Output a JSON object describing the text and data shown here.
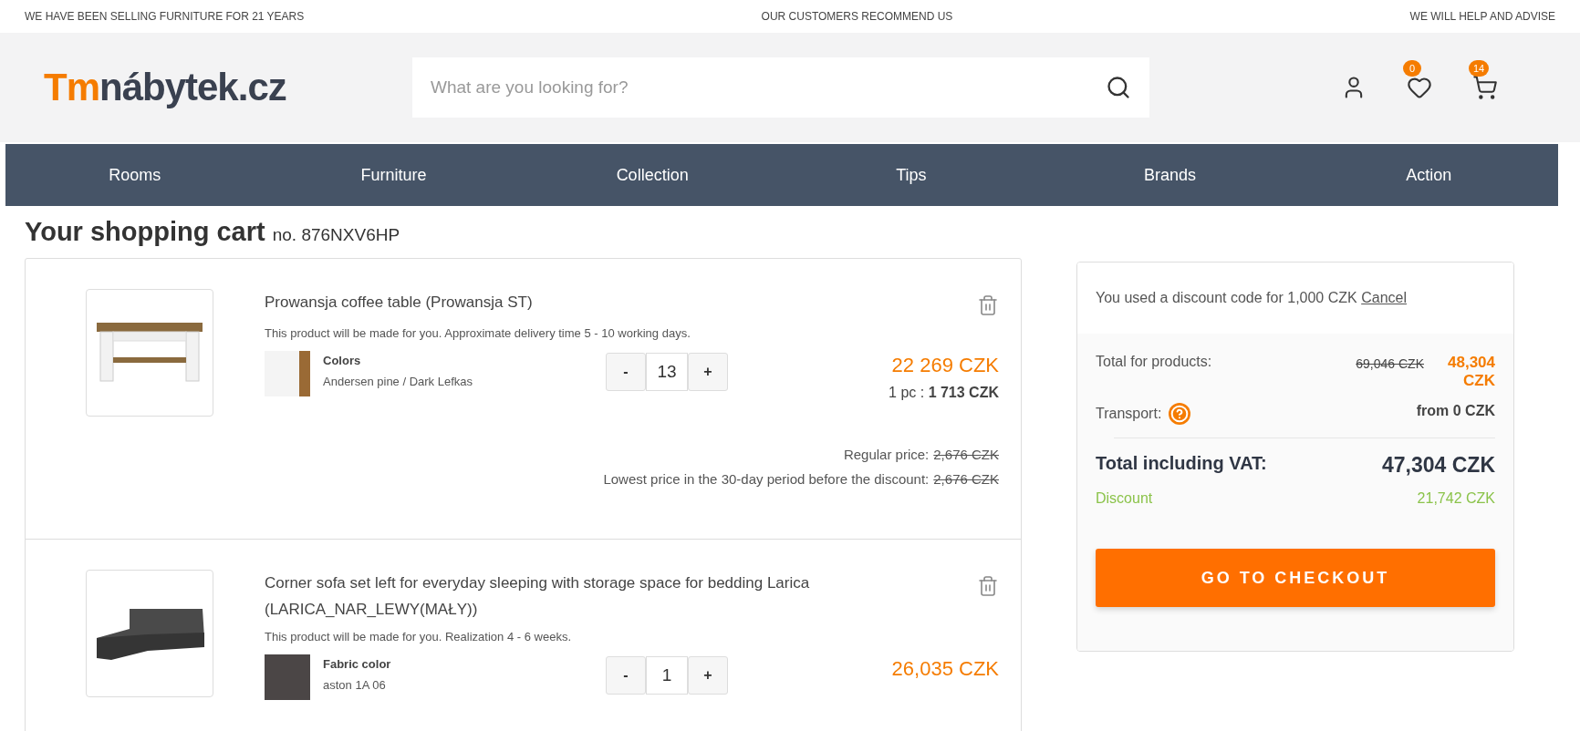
{
  "top_bar": [
    "WE HAVE BEEN SELLING FURNITURE FOR 21 YEARS",
    "OUR CUSTOMERS RECOMMEND US",
    "WE WILL HELP AND ADVISE"
  ],
  "logo": {
    "accent": "Tm",
    "rest": "nábytek.cz"
  },
  "search": {
    "placeholder": "What are you looking for?"
  },
  "header_icons": [
    {
      "kind": "user"
    },
    {
      "kind": "heart",
      "badge": "0"
    },
    {
      "kind": "cart",
      "badge": "14"
    }
  ],
  "nav": [
    "Rooms",
    "Furniture",
    "Collection",
    "Tips",
    "Brands",
    "Action"
  ],
  "cart": {
    "title": "Your shopping cart",
    "number": "no. 876NXV6HP",
    "items": [
      {
        "kind": "table",
        "name": "Prowansja coffee table (Prowansja ST)",
        "note": "This product will be made for you. Approximate delivery time 5 - 10 working days.",
        "option_label": "Colors",
        "option_value": "Andersen pine / Dark Lefkas",
        "minus": "-",
        "quantity": "13",
        "plus": "+",
        "price": "22 269 CZK",
        "unit_price": "1 pc : **1 713 CZK**",
        "price_lines": [
          {
            "label": "Regular price:",
            "old": "2,676 CZK"
          },
          {
            "label": "Lowest price in the 30-day period before the discount:",
            "old": "2,676 CZK"
          }
        ]
      },
      {
        "kind": "sofa",
        "name": "Corner sofa set left for everyday sleeping with storage space for bedding Larica (LARICA_NAR_LEWY(MAŁY))",
        "note": "This product will be made for you. Realization 4 - 6 weeks.",
        "option_label": "Fabric color",
        "option_value": "aston 1A 06",
        "minus": "-",
        "quantity": "1",
        "plus": "+",
        "price": "26,035 CZK"
      }
    ]
  },
  "summary": {
    "discount_note": "You used a discount code for 1,000 CZK",
    "cancel_link": "Cancel",
    "products_label": "Total for products:",
    "products_old": "69,046 CZK",
    "products_new": "48,304 CZK",
    "transport_label": "Transport:",
    "transport_value": "from 0 CZK",
    "total_label": "Total including VAT:",
    "total_value": "47,304 CZK",
    "discount_label": "Discount",
    "discount_value": "21,742 CZK",
    "checkout": "GO TO CHECKOUT"
  }
}
